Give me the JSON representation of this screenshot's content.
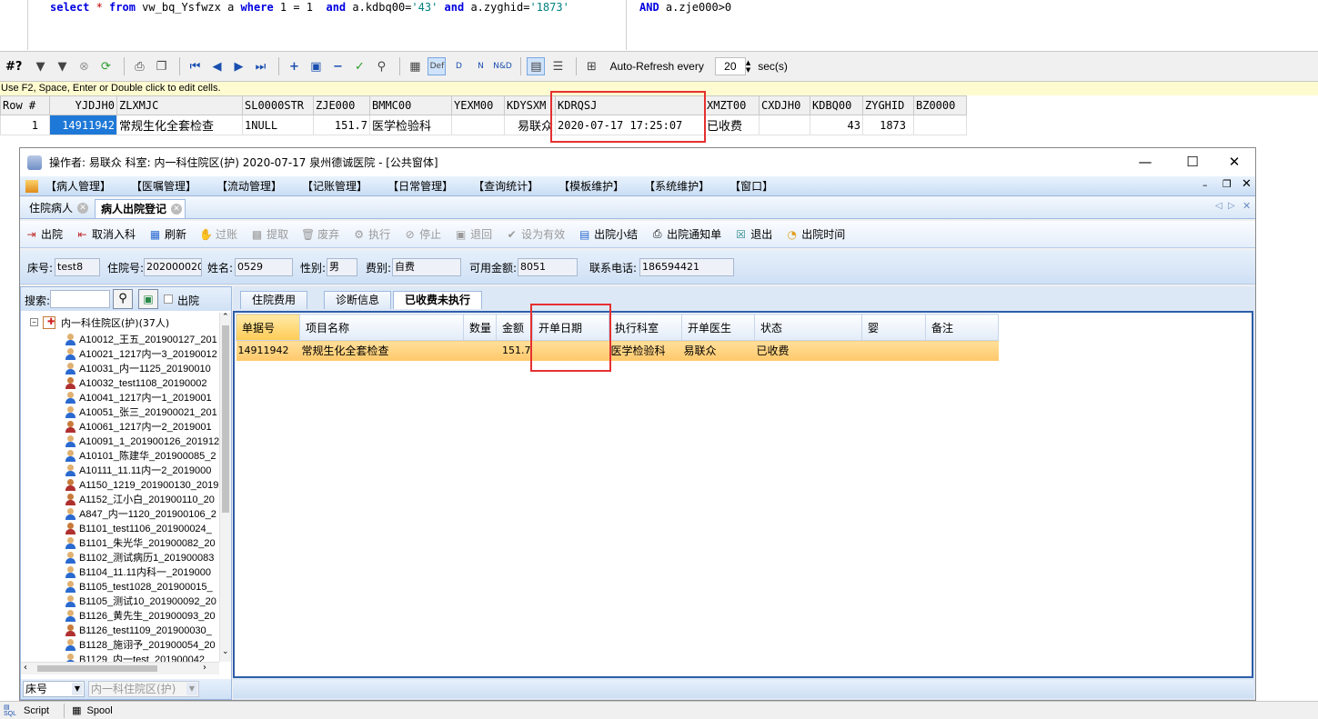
{
  "sql": {
    "line1_a": "select",
    "line1_b": " * ",
    "line1_c": "from",
    "line1_d": " vw_bq_Ysfwzx a ",
    "line1_e": "where",
    "line1_f": " 1 = 1  ",
    "line1_g": "and",
    "line1_h": " a.kdbq00=",
    "line1_i": "'43'",
    "line1_j": " and",
    "line1_k": " a.zyghid=",
    "line1_l": "'1873'",
    "line2_a": "AND",
    "line2_b": " a.zje000>0"
  },
  "grid_toolbar": {
    "hash_label": "#?",
    "auto_refresh_label": "Auto-Refresh every",
    "auto_refresh_value": "20",
    "secs_label": "sec(s)"
  },
  "hint": "Use F2, Space, Enter or Double click to edit cells.",
  "result_grid": {
    "columns": [
      "Row #",
      "YJDJH0",
      "ZLXMJC",
      "SL0000STR",
      "ZJE000",
      "BMMC00",
      "YEXM00",
      "KDYSXM",
      "KDRQSJ",
      "XMZT00",
      "CXDJH0",
      "KDBQ00",
      "ZYGHID",
      "BZ0000"
    ],
    "row": [
      "1",
      "14911942",
      "常规生化全套检查",
      "1NULL",
      "151.7",
      "医学检验科",
      "",
      "易联众",
      "2020-07-17 17:25:07",
      "已收费",
      "",
      "43",
      "1873",
      ""
    ]
  },
  "his": {
    "title": "操作者: 易联众  科室: 内一科住院区(护)  2020-07-17  泉州德诚医院 - [公共窗体]",
    "menus": [
      "【病人管理】",
      "【医嘱管理】",
      "【流动管理】",
      "【记账管理】",
      "【日常管理】",
      "【查询统计】",
      "【模板维护】",
      "【系统维护】",
      "【窗口】"
    ],
    "tabs": [
      "住院病人",
      "病人出院登记"
    ],
    "actions": {
      "discharge": "出院",
      "cancel_admit": "取消入科",
      "refresh": "刷新",
      "post": "过账",
      "extract": "提取",
      "void": "废弃",
      "execute": "执行",
      "stop": "停止",
      "return": "退回",
      "set_valid": "设为有效",
      "summary": "出院小结",
      "notice": "出院通知单",
      "exit": "退出",
      "time": "出院时间"
    },
    "info": {
      "bed_label": "床号:",
      "bed_value": "test8",
      "admit_label": "住院号:",
      "admit_value": "202000020",
      "name_label": "姓名:",
      "name_value": "0529",
      "sex_label": "性别:",
      "sex_value": "男",
      "fee_label": "费别:",
      "fee_value": "自费",
      "balance_label": "可用金额:",
      "balance_value": "8051",
      "phone_label": "联系电话:",
      "phone_value": "186594421"
    },
    "search_label": "搜索:",
    "discharge_check_label": "出院",
    "tree_root": "内一科住院区(护)(37人)",
    "patients": [
      {
        "label": "A10012_王五_201900127_201",
        "sex": "m"
      },
      {
        "label": "A10021_1217内一3_20190012",
        "sex": "m"
      },
      {
        "label": "A10031_内一1125_20190010",
        "sex": "m"
      },
      {
        "label": "A10032_test1108_20190002",
        "sex": "f"
      },
      {
        "label": "A10041_1217内一1_2019001",
        "sex": "m"
      },
      {
        "label": "A10051_张三_201900021_201",
        "sex": "m"
      },
      {
        "label": "A10061_1217内一2_2019001",
        "sex": "f"
      },
      {
        "label": "A10091_1_201900126_201912",
        "sex": "m"
      },
      {
        "label": "A10101_陈建华_201900085_2",
        "sex": "m"
      },
      {
        "label": "A10111_11.11内一2_2019000",
        "sex": "m"
      },
      {
        "label": "A1150_1219_201900130_2019",
        "sex": "f"
      },
      {
        "label": "A1152_江小白_201900110_20",
        "sex": "f"
      },
      {
        "label": "A847_内一1120_201900106_2",
        "sex": "m"
      },
      {
        "label": "B1101_test1106_201900024_",
        "sex": "f"
      },
      {
        "label": "B1101_朱光华_201900082_20",
        "sex": "m"
      },
      {
        "label": "B1102_测试病历1_201900083",
        "sex": "m"
      },
      {
        "label": "B1104_11.11内科一_2019000",
        "sex": "m"
      },
      {
        "label": "B1105_test1028_201900015_",
        "sex": "m"
      },
      {
        "label": "B1105_测试10_201900092_20",
        "sex": "m"
      },
      {
        "label": "B1126_黄先生_201900093_20",
        "sex": "m"
      },
      {
        "label": "B1126_test1109_201900030_",
        "sex": "f"
      },
      {
        "label": "B1128_施诩予_201900054_20",
        "sex": "m"
      },
      {
        "label": "B1129_内一test_201900042_",
        "sex": "m"
      }
    ],
    "left_bottom": {
      "sort_value": "床号",
      "ward_value": "内一科住院区(护)"
    },
    "right_tabs": [
      "住院费用",
      "诊断信息",
      "已收费未执行"
    ],
    "detail_columns": [
      "单据号",
      "项目名称",
      "数量",
      "金额",
      "开单日期",
      "执行科室",
      "开单医生",
      "状态",
      "婴",
      "备注"
    ],
    "detail_row": [
      "14911942",
      "常规生化全套检查",
      "",
      "151.7",
      "",
      "医学检验科",
      "易联众",
      "已收费",
      "",
      ""
    ]
  },
  "bottom_tabs": [
    "Script",
    "Spool"
  ],
  "colors": {
    "highlight": "#e53030",
    "selection": "#1e78d7",
    "row_orange": "#ffc86a"
  }
}
